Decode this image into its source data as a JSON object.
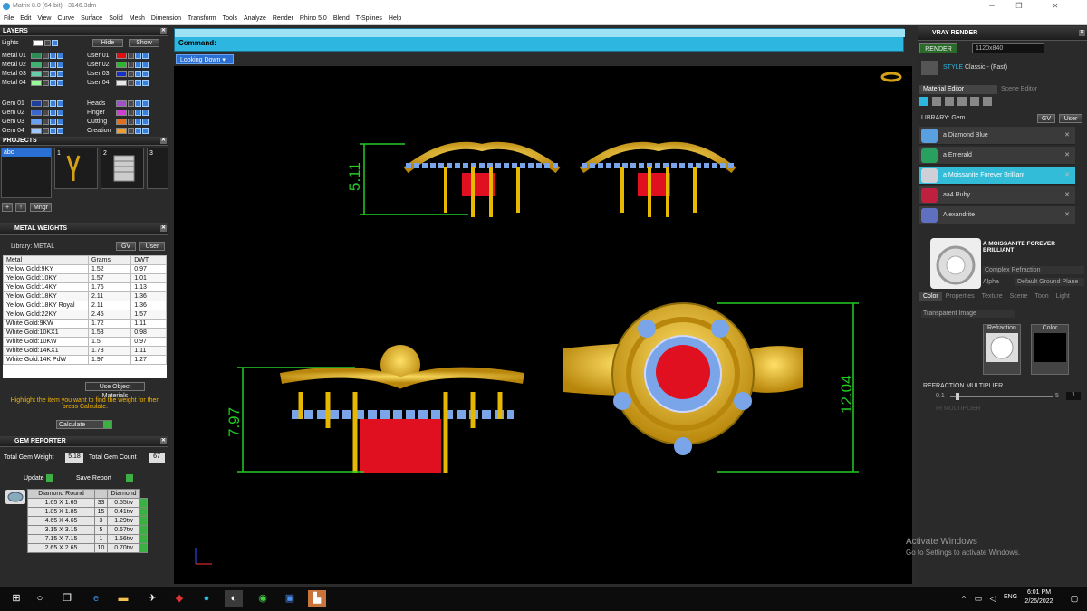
{
  "window": {
    "title": "Matrix 8.0 (64-bit) - 3146.3dm",
    "minimize": "─",
    "restore": "❐",
    "close": "✕"
  },
  "menu": [
    "File",
    "Edit",
    "View",
    "Curve",
    "Surface",
    "Solid",
    "Mesh",
    "Dimension",
    "Transform",
    "Tools",
    "Analyze",
    "Render",
    "Rhino 5.0",
    "Blend",
    "T-Splines",
    "Help"
  ],
  "layers": {
    "title": "LAYERS",
    "lights": "Lights",
    "hide": "Hide",
    "show": "Show",
    "left": [
      {
        "name": "Metal 01",
        "color": "#2e8b57"
      },
      {
        "name": "Metal 02",
        "color": "#3cb371"
      },
      {
        "name": "Metal 03",
        "color": "#66cdaa"
      },
      {
        "name": "Metal 04",
        "color": "#98fb98"
      },
      {
        "name": "Gem 01",
        "color": "#1e3fa0"
      },
      {
        "name": "Gem 02",
        "color": "#3a66d0"
      },
      {
        "name": "Gem 03",
        "color": "#6aa0f0"
      },
      {
        "name": "Gem 04",
        "color": "#a0c8ff"
      }
    ],
    "right": [
      {
        "name": "User 01",
        "color": "#e01010"
      },
      {
        "name": "User 02",
        "color": "#2db52d"
      },
      {
        "name": "User 03",
        "color": "#1530c8"
      },
      {
        "name": "User 04",
        "color": "#e8e8e8"
      },
      {
        "name": "Heads",
        "color": "#a050c8"
      },
      {
        "name": "Finger",
        "color": "#d040d0"
      },
      {
        "name": "Cutting",
        "color": "#e07020"
      },
      {
        "name": "Creation",
        "color": "#e8a030"
      }
    ]
  },
  "projects": {
    "title": "PROJECTS",
    "item": "abc",
    "thumbs": [
      "1",
      "2",
      "3"
    ],
    "mngr": "Mngr"
  },
  "metal_weights": {
    "title": "METAL WEIGHTS",
    "library_label": "Library: METAL",
    "gv": "GV",
    "user": "User",
    "columns": [
      "Metal",
      "Grams",
      "DWT"
    ],
    "rows": [
      [
        "Yellow Gold:9KY",
        "1.52",
        "0.97"
      ],
      [
        "Yellow Gold:10KY",
        "1.57",
        "1.01"
      ],
      [
        "Yellow Gold:14KY",
        "1.76",
        "1.13"
      ],
      [
        "Yellow Gold:18KY",
        "2.11",
        "1.36"
      ],
      [
        "Yellow Gold:18KY Royal",
        "2.11",
        "1.36"
      ],
      [
        "Yellow Gold:22KY",
        "2.45",
        "1.57"
      ],
      [
        "White Gold:9KW",
        "1.72",
        "1.11"
      ],
      [
        "White Gold:10KX1",
        "1.53",
        "0.98"
      ],
      [
        "White Gold:10KW",
        "1.5",
        "0.97"
      ],
      [
        "White Gold:14KX1",
        "1.73",
        "1.11"
      ],
      [
        "White Gold:14K PdW",
        "1.97",
        "1.27"
      ]
    ],
    "use_object_materials": "Use Object Materials",
    "hint": "Highlight the item you want to find the weight for then press Calculate.",
    "calculate": "Calculate"
  },
  "gem_reporter": {
    "title": "GEM REPORTER",
    "total_weight_label": "Total Gem Weight",
    "total_weight": "5.18",
    "total_count_label": "Total Gem Count",
    "total_count": "67",
    "update": "Update",
    "save_report": "Save Report",
    "columns": [
      "Diamond Round",
      "",
      "Diamond"
    ],
    "rows": [
      [
        "1.65 X 1.65",
        "33",
        "0.55tw"
      ],
      [
        "1.85 X 1.85",
        "15",
        "0.41tw"
      ],
      [
        "4.65 X 4.65",
        "3",
        "1.29tw"
      ],
      [
        "3.15 X 3.15",
        "5",
        "0.67tw"
      ],
      [
        "7.15 X 7.15",
        "1",
        "1.56tw"
      ],
      [
        "2.65 X 2.65",
        "10",
        "0.70tw"
      ]
    ]
  },
  "command": {
    "label": "Command:",
    "view": "Looking Down"
  },
  "dimensions": {
    "front_height": "5.11",
    "side_height": "7.97",
    "top_height": "12.04"
  },
  "vray": {
    "title": "VRAY RENDER",
    "render": "RENDER",
    "resolution": "1120x840",
    "style_label": "STYLE",
    "style_value": "Classic - (Fast)",
    "tabs": [
      "Material Editor",
      "Scene Editor"
    ],
    "library_label": "LIBRARY: Gem",
    "gv": "GV",
    "user": "User",
    "materials": [
      {
        "name": "a Diamond Blue",
        "color": "#5aa0e0"
      },
      {
        "name": "a Emerald",
        "color": "#2aa060"
      },
      {
        "name": "a Moissanite Forever Brilliant",
        "color": "#cfcfd8"
      },
      {
        "name": "aa4 Ruby",
        "color": "#c02040"
      },
      {
        "name": "Alexandrite",
        "color": "#6070c0"
      }
    ],
    "selected_material": "A MOISSANITE FOREVER BRILLIANT",
    "complex_refraction": "Complex Refraction",
    "alpha": "Alpha",
    "ground_plane": "Default Ground Plane",
    "sub_tabs": [
      "Color",
      "Properties",
      "Texture",
      "Scene",
      "Toon",
      "Light"
    ],
    "transparent_image": "Transparent Image",
    "refraction": "Refraction",
    "color": "Color",
    "refraction_multiplier": "REFRACTION MULTIPLIER",
    "rm_min": "0.1",
    "rm_max": "5",
    "rm_value": "1",
    "ir_multiplier": "IR MULTIPLIER"
  },
  "activate": {
    "line1": "Activate Windows",
    "line2": "Go to Settings to activate Windows."
  },
  "taskbar": {
    "lang": "ENG",
    "time": "6:01 PM",
    "date": "2/26/2022"
  }
}
